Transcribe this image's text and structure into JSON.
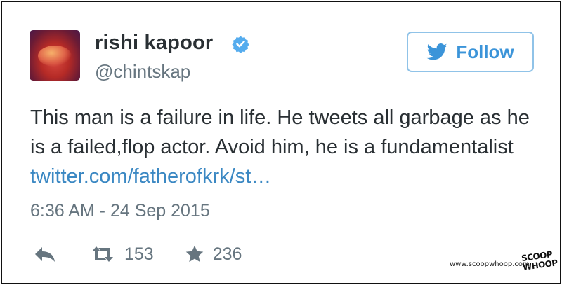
{
  "user": {
    "name": "rishi kapoor",
    "handle": "@chintskap",
    "verified": true
  },
  "follow_button": {
    "label": "Follow"
  },
  "tweet": {
    "text": "This man is a failure in life. He tweets all garbage as he is a failed,flop actor. Avoid him, he is a fundamentalist ",
    "link": "twitter.com/fatherofkrk/st…",
    "timestamp": "6:36 AM - 24 Sep 2015"
  },
  "actions": {
    "retweets": "153",
    "favorites": "236",
    "icons": [
      "reply-icon",
      "retweet-icon",
      "star-icon"
    ]
  },
  "watermark": {
    "site": "www.scoopwhoop.com",
    "logo_text": "SCOOP WHOOP"
  },
  "colors": {
    "link": "#3b88c3",
    "follow_accent": "#3b94d9",
    "muted": "#66757f",
    "verified_badge": "#55acee"
  }
}
